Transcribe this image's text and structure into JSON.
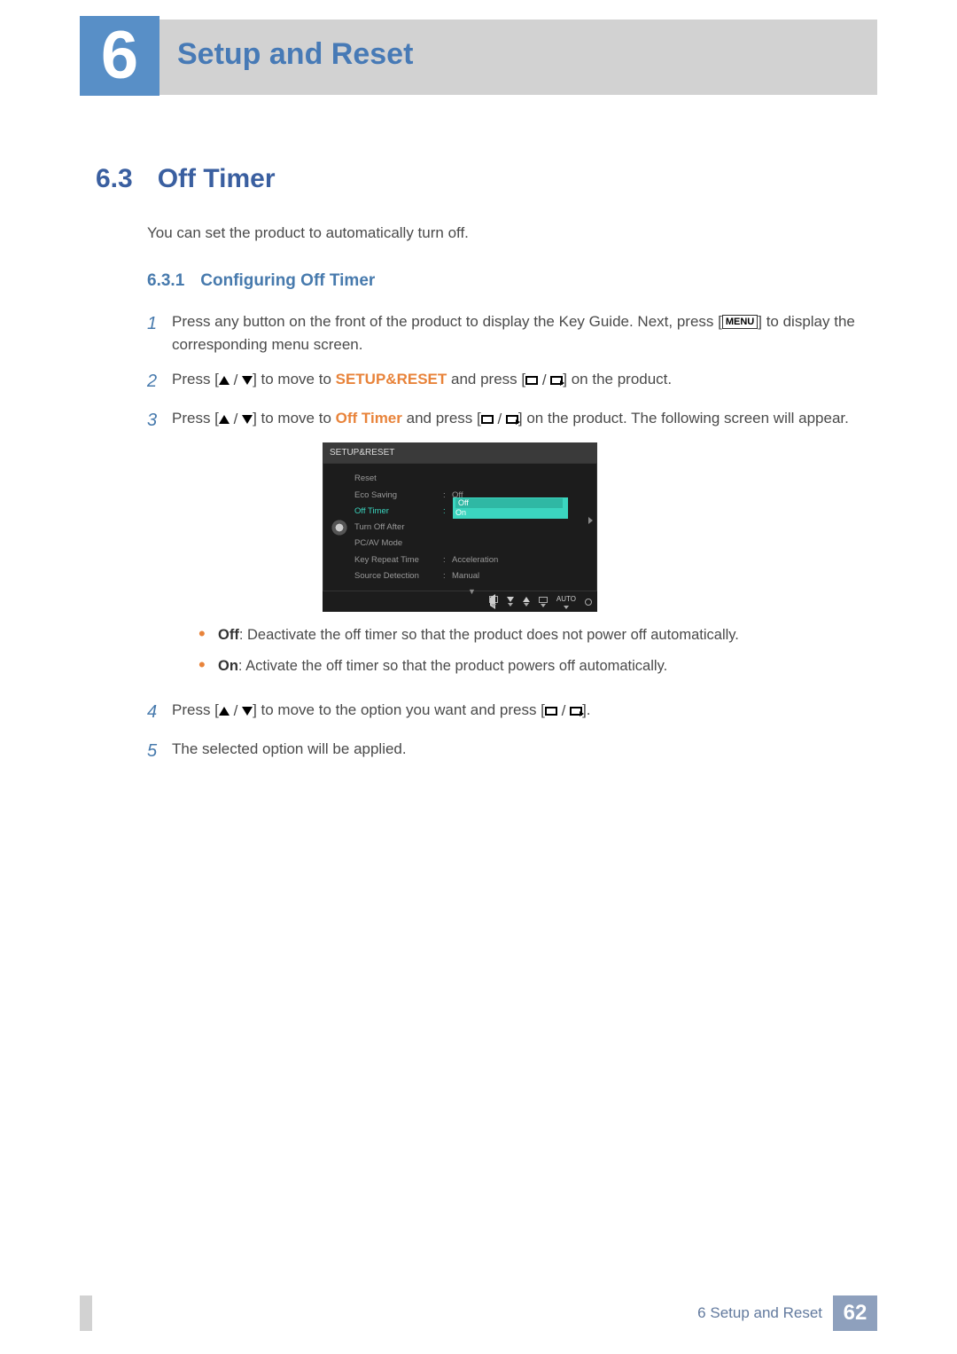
{
  "header": {
    "chapter_number": "6",
    "chapter_title": "Setup and Reset"
  },
  "section": {
    "number": "6.3",
    "title": "Off Timer",
    "intro": "You can set the product to automatically turn off."
  },
  "subsection": {
    "number": "6.3.1",
    "title": "Configuring Off Timer"
  },
  "steps": {
    "s1": {
      "num": "1",
      "text_a": "Press any button on the front of the product to display the Key Guide. Next, press [",
      "menu": "MENU",
      "text_b": "] to display the corresponding menu screen."
    },
    "s2": {
      "num": "2",
      "text_a": "Press [",
      "text_b": "] to move to ",
      "strong": "SETUP&RESET",
      "text_c": " and press [",
      "text_d": "] on the product."
    },
    "s3": {
      "num": "3",
      "text_a": "Press [",
      "text_b": "] to move to ",
      "strong": "Off Timer",
      "text_c": " and press [",
      "text_d": "] on the product. The following screen will appear."
    },
    "s4": {
      "num": "4",
      "text_a": "Press [",
      "text_b": "] to move to the option you want and press [",
      "text_c": "]."
    },
    "s5": {
      "num": "5",
      "text": "The selected option will be applied."
    }
  },
  "bullets": {
    "off_label": "Off",
    "off_desc": ": Deactivate the off timer so that the product does not power off automatically.",
    "on_label": "On",
    "on_desc": ": Activate the off timer so that the product powers off automatically."
  },
  "osd": {
    "title": "SETUP&RESET",
    "items": [
      {
        "label": "Reset",
        "value": ""
      },
      {
        "label": "Eco Saving",
        "value": "Off"
      },
      {
        "label": "Off Timer",
        "value": ""
      },
      {
        "label": "Turn Off After",
        "value": ""
      },
      {
        "label": "PC/AV Mode",
        "value": ""
      },
      {
        "label": "Key Repeat Time",
        "value": "Acceleration"
      },
      {
        "label": "Source Detection",
        "value": "Manual"
      }
    ],
    "dropdown": {
      "off": "Off",
      "on": "On"
    },
    "footer_auto": "AUTO"
  },
  "footer": {
    "chapter_label": "6 Setup and Reset",
    "page": "62"
  }
}
